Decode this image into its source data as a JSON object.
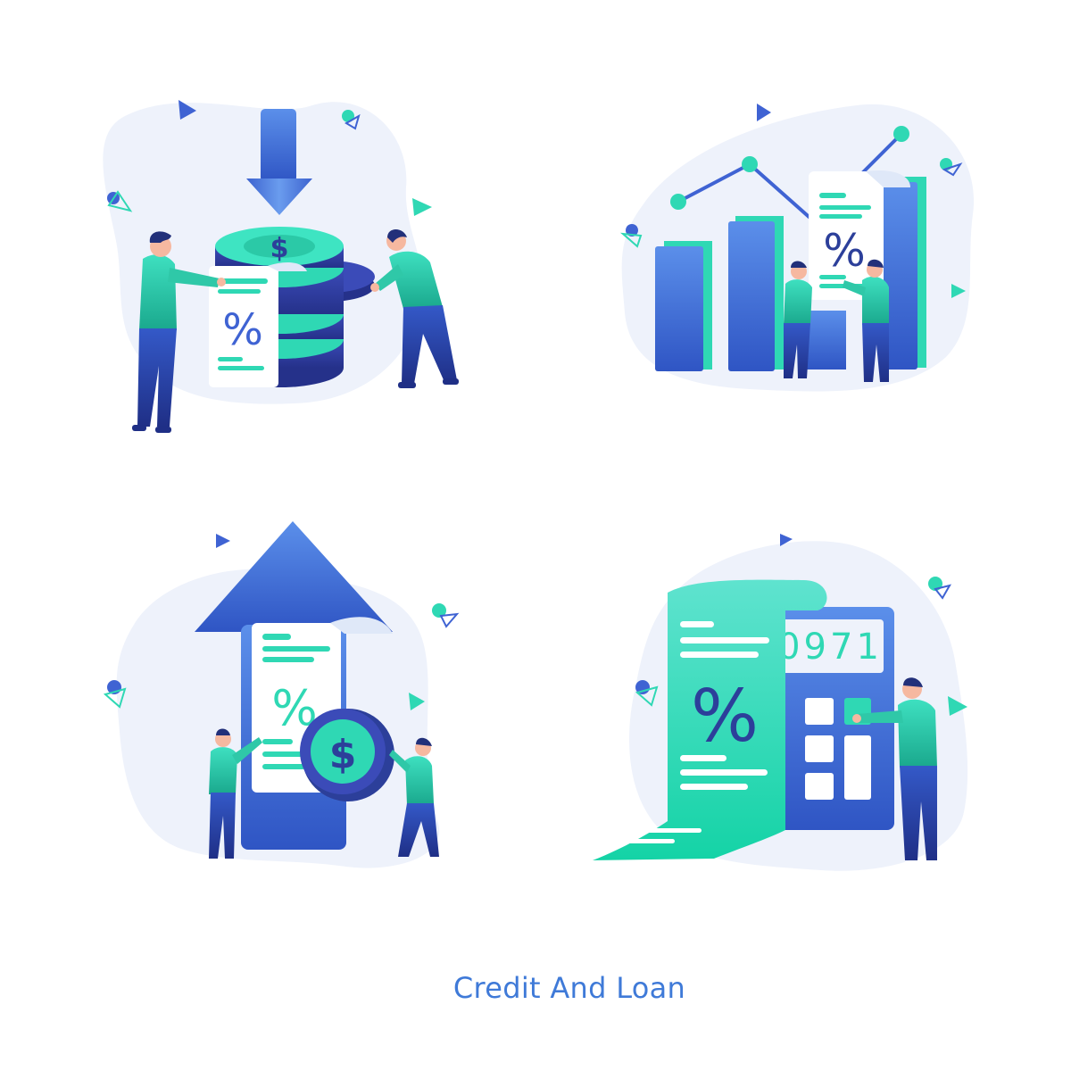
{
  "title": "Credit And Loan",
  "colors": {
    "blob": "#eef2fb",
    "blue": "#4a7ee0",
    "navy": "#2c3f9a",
    "teal": "#2fd8b4",
    "mint": "#7de8d2",
    "caption": "#3f7ad8"
  },
  "panels": [
    {
      "name": "interest-coins",
      "symbols": {
        "percent": "%",
        "dollar": "$"
      }
    },
    {
      "name": "bar-growth",
      "symbols": {
        "percent": "%"
      }
    },
    {
      "name": "rising-arrow",
      "symbols": {
        "percent": "%",
        "dollar": "$"
      }
    },
    {
      "name": "calculator",
      "symbols": {
        "percent": "%",
        "display": "0971"
      }
    }
  ]
}
